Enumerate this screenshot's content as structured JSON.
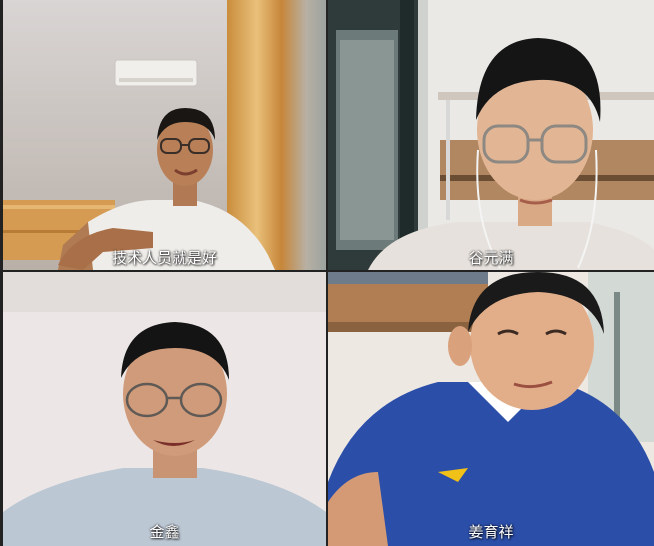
{
  "participants": [
    {
      "name": "技术人员就是好"
    },
    {
      "name": "谷元满"
    },
    {
      "name": "金鑫"
    },
    {
      "name": "姜育祥"
    }
  ],
  "colors": {
    "label_text": "#ffffff",
    "frame_gap": "#222222"
  }
}
